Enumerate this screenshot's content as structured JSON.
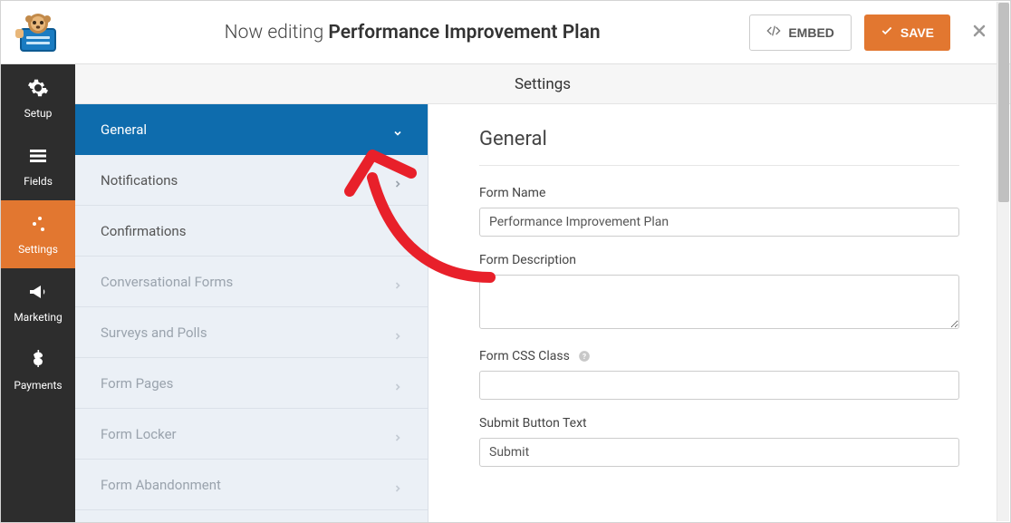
{
  "header": {
    "prefix": "Now editing",
    "form_name": "Performance Improvement Plan",
    "embed_label": "EMBED",
    "save_label": "SAVE"
  },
  "vnav": {
    "setup": "Setup",
    "fields": "Fields",
    "settings": "Settings",
    "marketing": "Marketing",
    "payments": "Payments"
  },
  "content_title": "Settings",
  "sidebar2": {
    "general": "General",
    "notifications": "Notifications",
    "confirmations": "Confirmations",
    "conversational": "Conversational Forms",
    "surveys": "Surveys and Polls",
    "form_pages": "Form Pages",
    "form_locker": "Form Locker",
    "form_abandonment": "Form Abandonment"
  },
  "panel": {
    "heading": "General",
    "fields": {
      "form_name": {
        "label": "Form Name",
        "value": "Performance Improvement Plan"
      },
      "form_description": {
        "label": "Form Description",
        "value": ""
      },
      "form_css_class": {
        "label": "Form CSS Class",
        "value": ""
      },
      "submit_button_text": {
        "label": "Submit Button Text",
        "value": "Submit"
      }
    }
  },
  "colors": {
    "accent_orange": "#e27730",
    "accent_blue": "#0e6cad"
  }
}
